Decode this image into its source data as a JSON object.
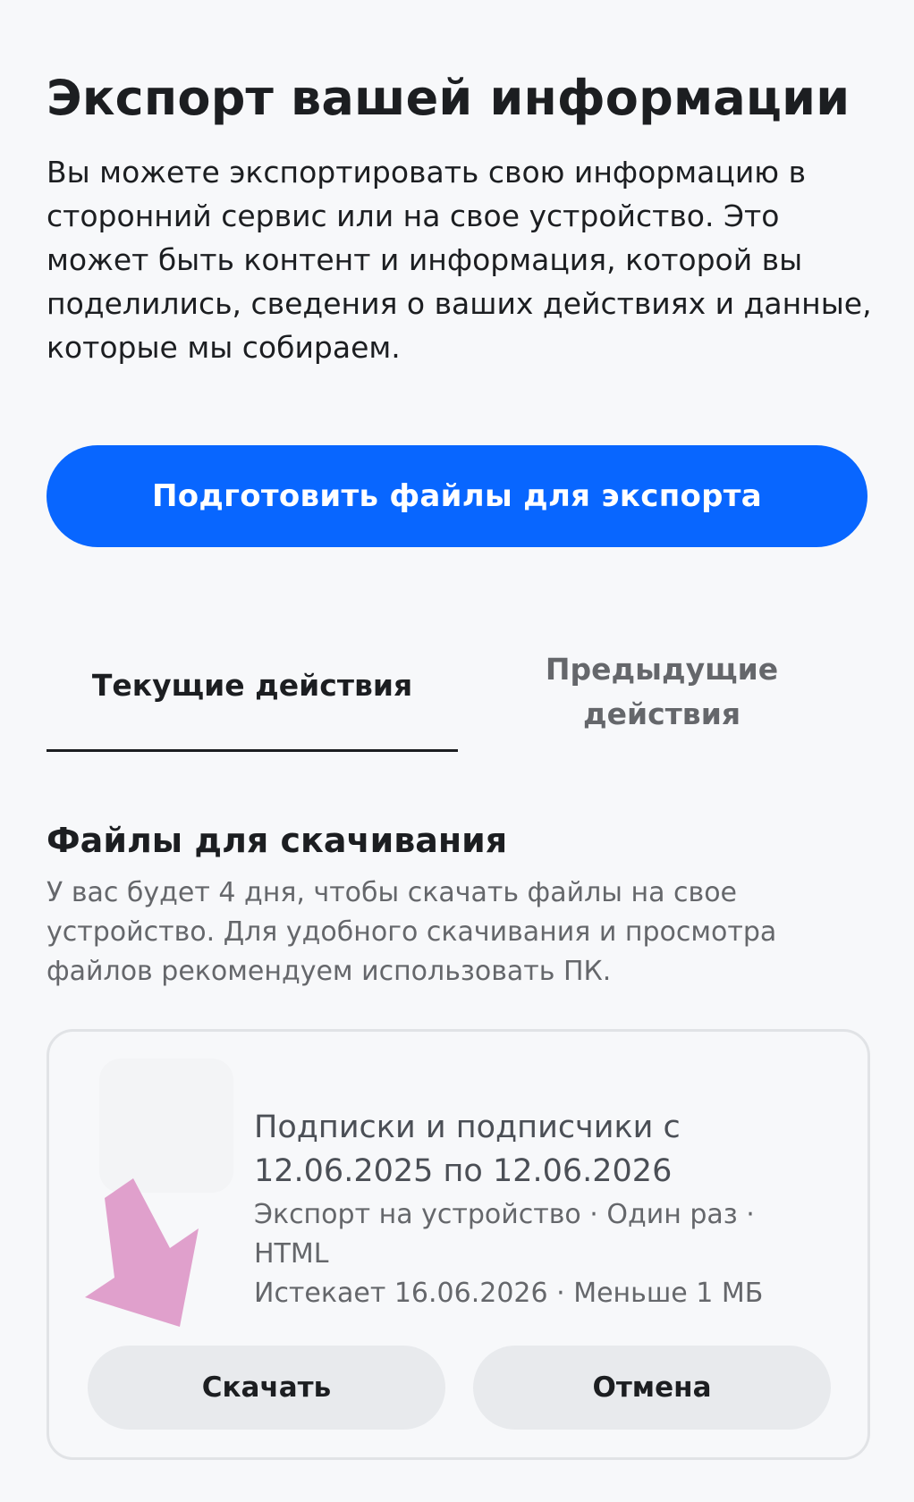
{
  "header": {
    "title": "Экспорт вашей информации",
    "description": "Вы можете экспортировать свою информацию в сторонний сервис или на свое устройство. Это может быть контент и информация, которой вы поделились, сведения о ваших действиях и данные, которые мы собираем."
  },
  "actions": {
    "prepare_button_label": "Подготовить файлы для экспорта"
  },
  "tabs": [
    {
      "label": "Текущие действия",
      "selected": true
    },
    {
      "label": "Предыдущие действия",
      "selected": false
    }
  ],
  "downloads": {
    "section_title": "Файлы для скачивания",
    "section_description": "У вас будет 4 дня, чтобы скачать файлы на свое устройство. Для удобного скачивания и просмотра файлов рекомендуем использовать ПК.",
    "file": {
      "name": "Подписки и подписчики с 12.06.2025 по 12.06.2026",
      "meta": "Экспорт на устройство · Один раз · HTML",
      "expiry": "Истекает 16.06.2026 · Меньше 1 МБ",
      "download_label": "Скачать",
      "cancel_label": "Отмена"
    }
  },
  "colors": {
    "primary": "#0866ff",
    "annotation_arrow": "#e0a0cc",
    "background": "#f7f8fa"
  }
}
